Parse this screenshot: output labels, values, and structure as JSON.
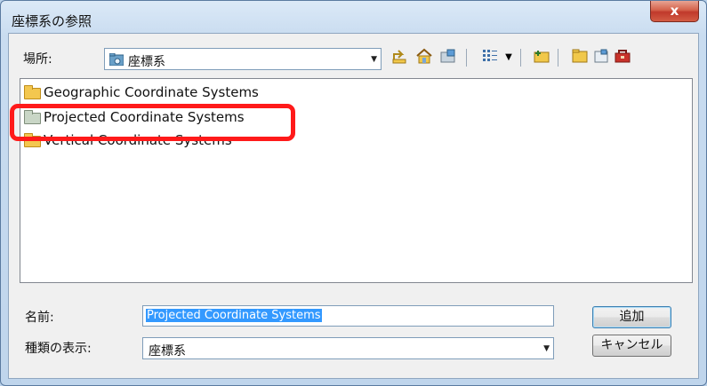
{
  "window": {
    "title": "座標系の参照",
    "close_label": "x"
  },
  "location": {
    "label": "場所:",
    "value": "座標系",
    "icon": "folder-icon"
  },
  "toolbar": {
    "icons": [
      "up-one-level-icon",
      "home-icon",
      "connect-folder-icon",
      "view-menu-icon",
      "new-folder-icon",
      "open-folder-icon",
      "catalog-icon",
      "toolbox-icon"
    ]
  },
  "list": {
    "items": [
      {
        "label": "Geographic Coordinate Systems",
        "icon": "folder-icon"
      },
      {
        "label": "Projected Coordinate Systems",
        "icon": "folder-icon",
        "selected": true
      },
      {
        "label": "Vertical Coordinate Systems",
        "icon": "folder-icon"
      }
    ]
  },
  "name": {
    "label": "名前:",
    "value": "Projected Coordinate Systems"
  },
  "filter": {
    "label": "種類の表示:",
    "value": "座標系"
  },
  "buttons": {
    "add": "追加",
    "cancel": "キャンセル"
  },
  "colors": {
    "annotation_box": "#ff1a1a",
    "selection": "#3399ff"
  }
}
